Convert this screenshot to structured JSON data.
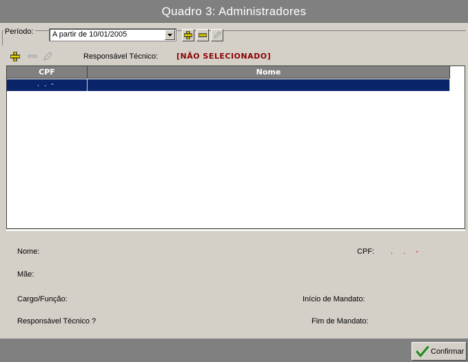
{
  "window": {
    "title": "Quadro 3: Administradores"
  },
  "periodo": {
    "label": "Período:",
    "selected": "A partir de 10/01/2005"
  },
  "toolbar": {
    "icons": [
      "plus-icon",
      "minus-icon",
      "pencil-icon"
    ]
  },
  "responsavel": {
    "label": "Responsável Técnico:",
    "value": "[NÃO SELECIONADO]"
  },
  "grid": {
    "columns": [
      "CPF",
      "Nome"
    ],
    "rows": [
      {
        "cpf": ".  .  -",
        "nome": ""
      }
    ]
  },
  "details": {
    "nome_label": "Nome:",
    "mae_label": "Mãe:",
    "cargo_label": "Cargo/Função:",
    "resp_tecnico_label": "Responsável Técnico ?",
    "cpf_label": "CPF:",
    "cpf_value": ". . -",
    "inicio_label": "Início de Mandato:",
    "fim_label": "Fim de Mandato:"
  },
  "footer": {
    "confirm_label": "Confirmar"
  },
  "colors": {
    "titlebar": "#808080",
    "selection": "#0a246a",
    "responsavel_value": "#8b0000",
    "cpf_value": "#c00000",
    "add_icon": "#e8d800"
  }
}
